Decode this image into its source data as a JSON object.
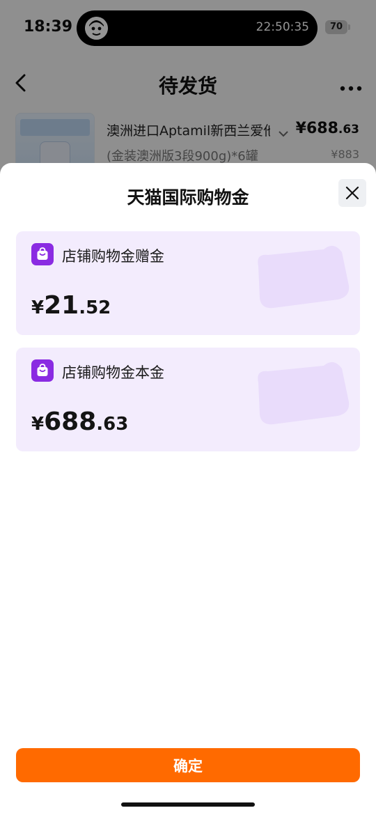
{
  "status_bar": {
    "time": "18:39",
    "island_time": "22:50:35",
    "battery": "70"
  },
  "nav": {
    "title": "待发货"
  },
  "product": {
    "name": "澳洲进口Aptamil新西兰爱他美",
    "price_int": "¥688",
    "price_dec": ".63",
    "spec": "(金装澳洲版3段900g)*6罐",
    "original_price": "¥883"
  },
  "sheet": {
    "title": "天猫国际购物金",
    "cards": [
      {
        "label": "店铺购物金赠金",
        "currency": "¥",
        "amount_int": "21",
        "amount_dec": ".52"
      },
      {
        "label": "店铺购物金本金",
        "currency": "¥",
        "amount_int": "688",
        "amount_dec": ".63"
      }
    ],
    "confirm_label": "确定"
  },
  "colors": {
    "accent_orange": "#ff6a00",
    "card_purple_bg": "#f3ecfd",
    "icon_purple": "#8a2be2"
  },
  "icons": [
    "back-arrow-icon",
    "more-icon",
    "chevron-down-icon",
    "close-icon",
    "shopping-bag-icon"
  ]
}
